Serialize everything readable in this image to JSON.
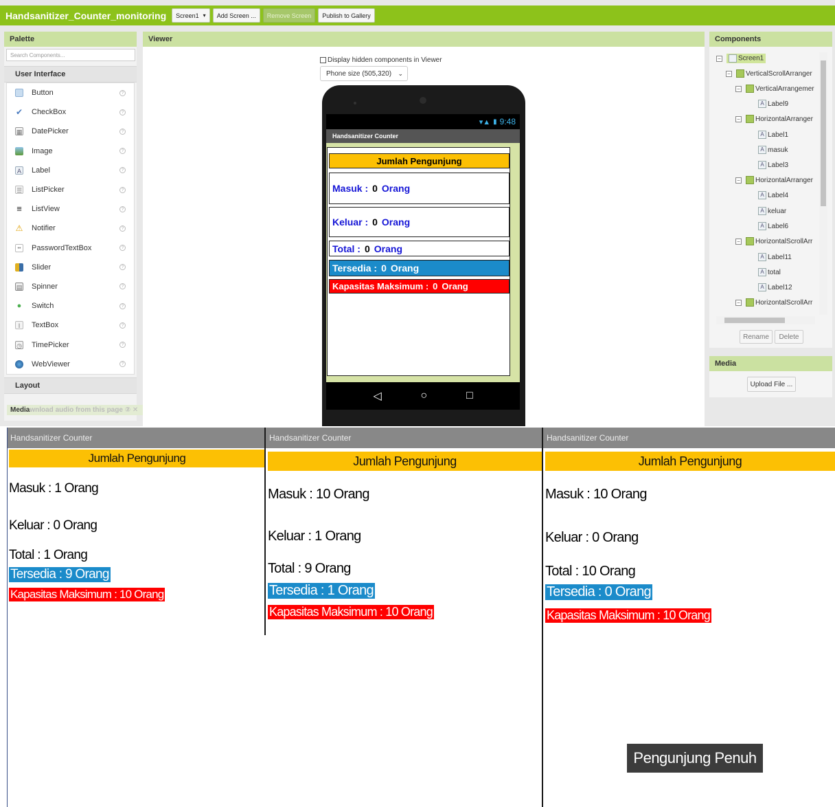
{
  "designer": {
    "project_title": "Handsanitizer_Counter_monitoring",
    "toolbar": {
      "screen_select": "Screen1",
      "add_screen": "Add Screen ...",
      "remove_screen": "Remove Screen",
      "publish": "Publish to Gallery"
    },
    "palette": {
      "header": "Palette",
      "search_placeholder": "Search Components...",
      "section_user_interface": "User Interface",
      "items": [
        {
          "label": "Button",
          "icon": "button-icon"
        },
        {
          "label": "CheckBox",
          "icon": "checkbox-icon"
        },
        {
          "label": "DatePicker",
          "icon": "datepicker-icon"
        },
        {
          "label": "Image",
          "icon": "image-icon"
        },
        {
          "label": "Label",
          "icon": "label-icon"
        },
        {
          "label": "ListPicker",
          "icon": "listpicker-icon"
        },
        {
          "label": "ListView",
          "icon": "listview-icon"
        },
        {
          "label": "Notifier",
          "icon": "notifier-icon"
        },
        {
          "label": "PasswordTextBox",
          "icon": "password-icon"
        },
        {
          "label": "Slider",
          "icon": "slider-icon"
        },
        {
          "label": "Spinner",
          "icon": "spinner-icon"
        },
        {
          "label": "Switch",
          "icon": "switch-icon"
        },
        {
          "label": "TextBox",
          "icon": "textbox-icon"
        },
        {
          "label": "TimePicker",
          "icon": "timepicker-icon"
        },
        {
          "label": "WebViewer",
          "icon": "webviewer-icon"
        }
      ],
      "section_layout": "Layout",
      "section_media": "Media",
      "overlay_text": "wnload audio from this page",
      "overlay_icons": "② ✕"
    },
    "viewer": {
      "header": "Viewer",
      "hidden_checkbox_label": "Display hidden components in Viewer",
      "phone_size": "Phone size (505,320)",
      "status_time": "9:48",
      "app_title": "Handsanitizer Counter",
      "jumlah_title": "Jumlah Pengunjung",
      "masuk_label": "Masuk :",
      "keluar_label": "Keluar :",
      "total_label": "Total :",
      "tersedia_label": "Tersedia :",
      "kapasitas_label": "Kapasitas Maksimum :",
      "value": "0",
      "unit": "Orang"
    },
    "components": {
      "header": "Components",
      "tree": [
        "Screen1",
        "VerticalScrollArranger",
        "VerticalArrangemer",
        "Label9",
        "HorizontalArranger",
        "Label1",
        "masuk",
        "Label3",
        "HorizontalArranger",
        "Label4",
        "keluar",
        "Label6",
        "HorizontalScrollArr",
        "Label11",
        "total",
        "Label12",
        "HorizontalScrollArr"
      ],
      "rename": "Rename",
      "delete": "Delete"
    },
    "media": {
      "header": "Media",
      "upload": "Upload File ..."
    }
  },
  "screenshots": [
    {
      "app_title": "Handsanitizer Counter",
      "jumlah_title": "Jumlah Pengunjung",
      "masuk": "Masuk : 1 Orang",
      "keluar": "Keluar : 0 Orang",
      "total": "Total  : 1 Orang",
      "tersedia": "Tersedia : 9 Orang",
      "kapasitas": "Kapasitas Maksimum : 10 Orang"
    },
    {
      "app_title": "Handsanitizer Counter",
      "jumlah_title": "Jumlah Pengunjung",
      "masuk": "Masuk : 10 Orang",
      "keluar": "Keluar : 1 Orang",
      "total": "Total  : 9 Orang",
      "tersedia": "Tersedia : 1 Orang",
      "kapasitas": "Kapasitas Maksimum : 10 Orang"
    },
    {
      "app_title": "Handsanitizer Counter",
      "jumlah_title": "Jumlah Pengunjung",
      "masuk": "Masuk : 10 Orang",
      "keluar": "Keluar : 0 Orang",
      "total": "Total  : 10 Orang",
      "tersedia": "Tersedia : 0 Orang",
      "kapasitas": "Kapasitas Maksimum : 10 Orang",
      "toast": "Pengunjung Penuh"
    }
  ],
  "colors": {
    "topbar": "#8dc21b",
    "panel_header": "#cbe1a1",
    "title_yellow": "#fcc004",
    "tersedia_blue": "#1b8bca",
    "kapasitas_red": "#ff0000",
    "label_blue": "#1515d6"
  }
}
